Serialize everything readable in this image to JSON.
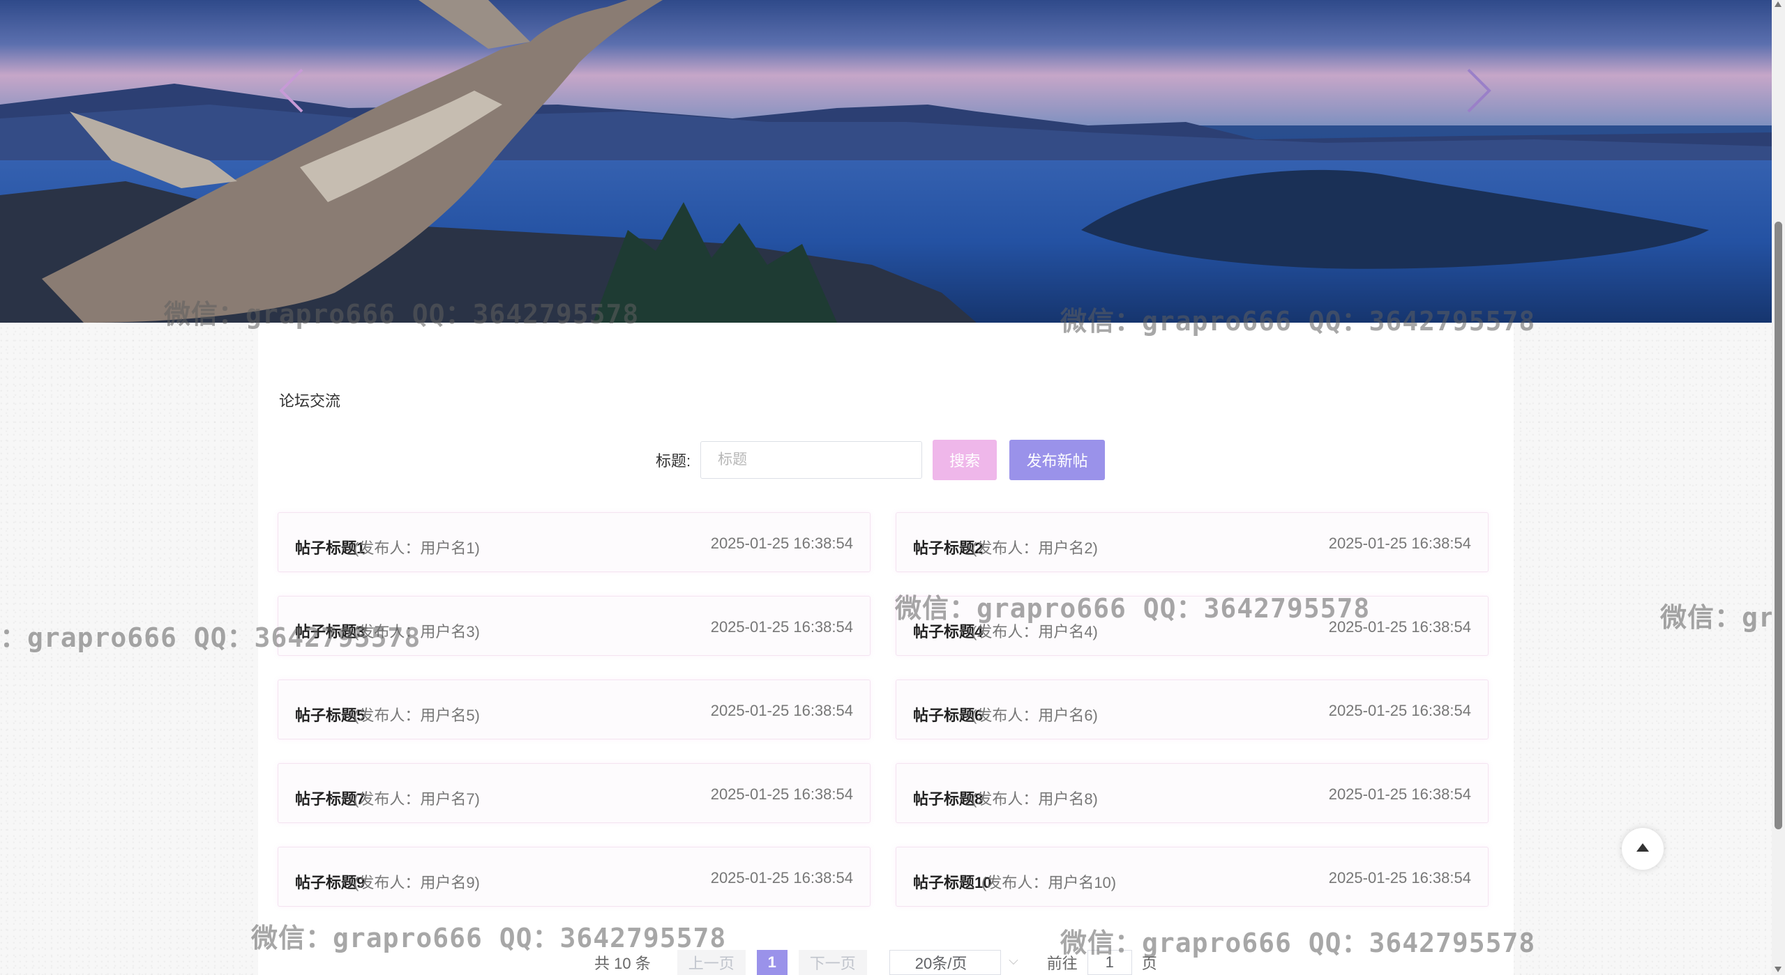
{
  "banner": {
    "prev_arrow": "chevron-left-icon",
    "next_arrow": "chevron-right-icon"
  },
  "watermark_text": "微信：grapro666 QQ：3642795578",
  "watermark_partial_left": "：grapro666 QQ：3642795578",
  "watermark_partial_right": "微信：gr",
  "forum": {
    "section_title": "论坛交流",
    "search": {
      "label": "标题:",
      "placeholder": "标题",
      "value": "",
      "search_label": "搜索",
      "publish_label": "发布新帖"
    },
    "posts": [
      {
        "title": "帖子标题1",
        "author": "(发布人：用户名1)",
        "time": "2025-01-25 16:38:54"
      },
      {
        "title": "帖子标题2",
        "author": "(发布人：用户名2)",
        "time": "2025-01-25 16:38:54"
      },
      {
        "title": "帖子标题3",
        "author": "(发布人：用户名3)",
        "time": "2025-01-25 16:38:54"
      },
      {
        "title": "帖子标题4",
        "author": "(发布人：用户名4)",
        "time": "2025-01-25 16:38:54"
      },
      {
        "title": "帖子标题5",
        "author": "(发布人：用户名5)",
        "time": "2025-01-25 16:38:54"
      },
      {
        "title": "帖子标题6",
        "author": "(发布人：用户名6)",
        "time": "2025-01-25 16:38:54"
      },
      {
        "title": "帖子标题7",
        "author": "(发布人：用户名7)",
        "time": "2025-01-25 16:38:54"
      },
      {
        "title": "帖子标题8",
        "author": "(发布人：用户名8)",
        "time": "2025-01-25 16:38:54"
      },
      {
        "title": "帖子标题9",
        "author": "(发布人：用户名9)",
        "time": "2025-01-25 16:38:54"
      },
      {
        "title": "帖子标题10",
        "author": "(发布人：用户名10)",
        "time": "2025-01-25 16:38:54"
      }
    ]
  },
  "pagination": {
    "total": "共 10 条",
    "prev": "上一页",
    "current": "1",
    "next": "下一页",
    "page_size": "20条/页",
    "goto": "前往",
    "jump_value": "1",
    "page_unit": "页"
  },
  "colors": {
    "search_button": "#efb7ea",
    "publish_button": "#9a92ea",
    "active_page": "#9a92ea"
  }
}
